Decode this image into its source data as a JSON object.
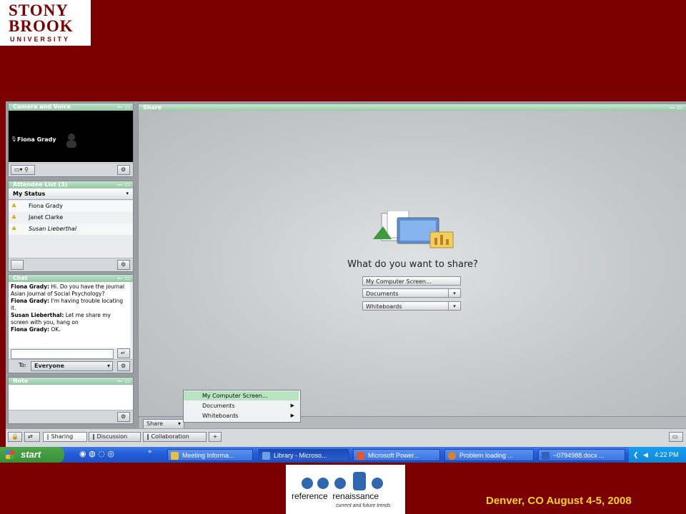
{
  "logo": {
    "line1": "STONY",
    "line2": "BROOK",
    "line3": "UNIVERSITY"
  },
  "camera_pod": {
    "title": "Camera and Voice",
    "user": "Fiona Grady"
  },
  "attendee_pod": {
    "title": "Attendee List (3)",
    "status_label": "My Status",
    "attendees": [
      "Fiona Grady",
      "Janet Clarke",
      "Susan Lieberthal"
    ]
  },
  "chat_pod": {
    "title": "Chat",
    "messages": [
      {
        "sender": "Fiona Grady:",
        "text": "Hi. Do you have the journal Asian Journal of Social Psychology?"
      },
      {
        "sender": "Fiona Grady:",
        "text": "I'm having trouble locating it."
      },
      {
        "sender": "Susan Lieberthal:",
        "text": "Let me share my screen with you, hang on"
      },
      {
        "sender": "Fiona Grady:",
        "text": "OK."
      }
    ],
    "to_label": "To:",
    "to_value": "Everyone"
  },
  "note_pod": {
    "title": "Note"
  },
  "share_pod": {
    "title": "Share",
    "question": "What do you want to share?",
    "options": [
      "My Computer Screen...",
      "Documents",
      "Whiteboards"
    ],
    "share_button": "Share"
  },
  "popup_menu": {
    "items": [
      "My Computer Screen...",
      "Documents",
      "Whiteboards"
    ]
  },
  "tabs": [
    "Sharing",
    "Discussion",
    "Collaboration"
  ],
  "taskbar": {
    "start": "start",
    "windows": [
      "Meeting Informa...",
      "Library - Microso...",
      "Microsoft Power...",
      "Problem loading ...",
      "~0794988.docx ..."
    ],
    "clock": "4:22 PM"
  },
  "bottom_logo": {
    "word1": "reference",
    "word2": "renaissance",
    "tagline": "current and future trends"
  },
  "footer": {
    "text": "Denver, CO August 4-5, 2008"
  },
  "colors": {
    "background": "#7b0000",
    "footer_text": "#ffd21f",
    "pod_header": "#99cca9"
  }
}
